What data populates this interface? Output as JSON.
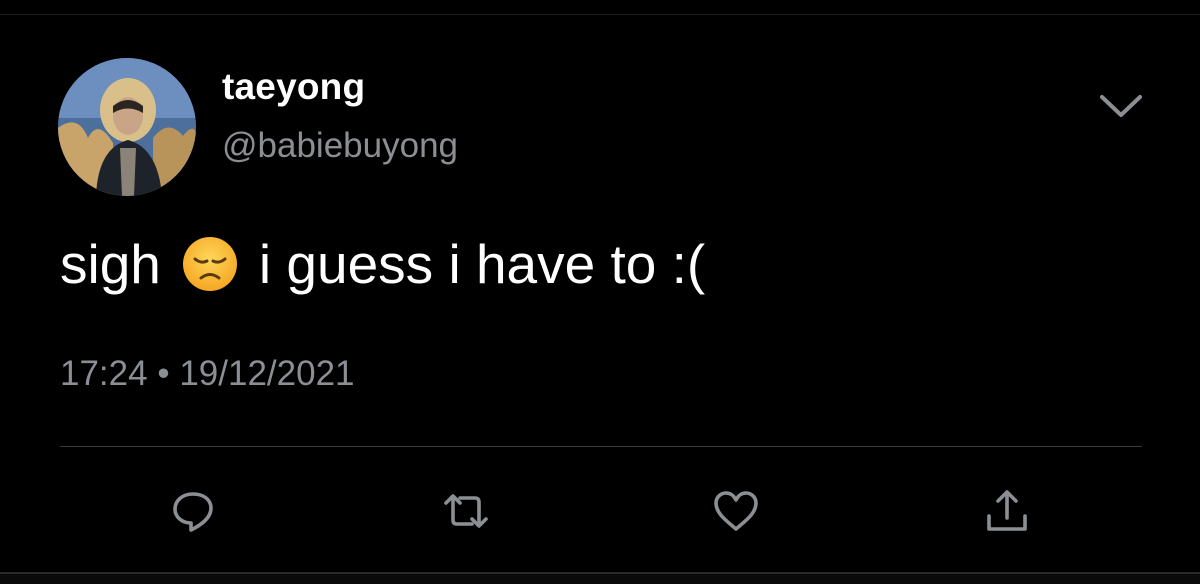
{
  "tweet": {
    "display_name": "taeyong",
    "handle": "@babiebuyong",
    "text_before_emoji": "sigh",
    "emoji": "disappointed-face",
    "text_after_emoji": "i guess i have to :(",
    "time": "17:24",
    "separator": "•",
    "date": "19/12/2021"
  },
  "icons": {
    "menu": "chevron-down-icon",
    "reply": "reply-icon",
    "retweet": "retweet-icon",
    "like": "heart-icon",
    "share": "share-icon"
  },
  "colors": {
    "background": "#000000",
    "text_primary": "#ffffff",
    "text_secondary": "#8b8f94",
    "icon": "#8b8f94"
  }
}
